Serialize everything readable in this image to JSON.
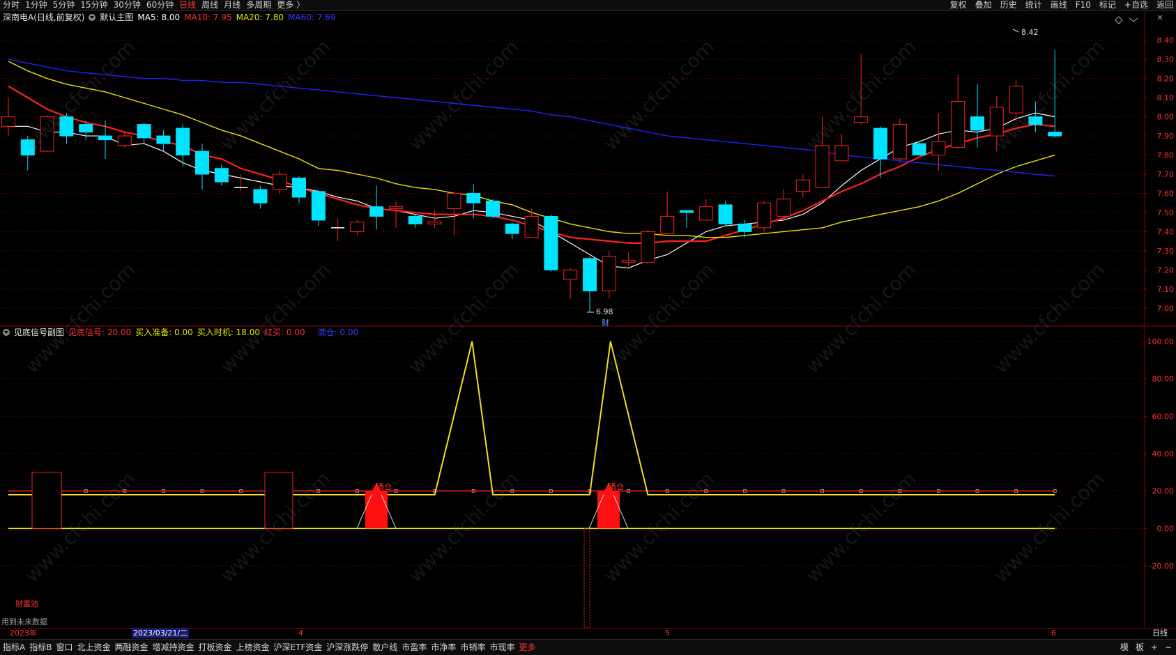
{
  "topbar": {
    "periods": [
      "分时",
      "1分钟",
      "5分钟",
      "15分钟",
      "30分钟",
      "60分钟",
      "日线",
      "周线",
      "月线",
      "多周期",
      "更多 〉"
    ],
    "active_period": "日线",
    "tools": [
      "复权",
      "叠加",
      "历史",
      "统计",
      "画线",
      "F10",
      "标记",
      "+自选",
      "返回"
    ]
  },
  "main_chart": {
    "stock": "深南电A(日线,前复权)",
    "template": "默认主图",
    "ma5": "MA5: 8.00",
    "ma10": "MA10: 7.95",
    "ma20": "MA20: 7.80",
    "ma60": "MA60: 7.69",
    "high_label": "8.42",
    "low_label": "6.98",
    "cai_mark": "财",
    "y_ticks": [
      "8.40",
      "8.30",
      "8.20",
      "8.10",
      "8.00",
      "7.90",
      "7.80",
      "7.70",
      "7.60",
      "7.50",
      "7.40",
      "7.30",
      "7.20",
      "7.10",
      "7.00"
    ],
    "colors": {
      "ma5": "#ffffff",
      "ma10": "#ff2020",
      "ma20": "#e6e600",
      "ma60": "#2020ff",
      "up": "#ff2020",
      "down": "#00e5ff"
    }
  },
  "sub_chart": {
    "name": "见底信号副图",
    "signal": "见底信号: 20.00",
    "prepare": "买入准备: 0.00",
    "timing": "买入时机: 18.00",
    "red_buy": "红买: 0.00",
    "blue_label": "満仓: 0.00",
    "full_label_1": "満仓",
    "full_label_2": "満仓",
    "y_ticks": [
      "100.00",
      "80.00",
      "60.00",
      "40.00",
      "20.00",
      "0.00",
      "-20.00"
    ],
    "note_left": "财富池",
    "note_future": "用到未来数据"
  },
  "time_axis": {
    "year": "2023年",
    "highlight_date": "2023/03/21/二",
    "month_4": "4",
    "month_5": "5",
    "month_6": "6",
    "right_label": "日线"
  },
  "bottombar": {
    "items": [
      "指标A",
      "指标B",
      "窗口",
      "北上资金",
      "两融资金",
      "增减持资金",
      "打板资金",
      "上榜资金",
      "沪深ETF资金",
      "沪深涨跌停",
      "散户线",
      "市盈率",
      "市净率",
      "市销率",
      "市现率",
      "更多"
    ],
    "right_items": [
      "模",
      "板",
      "+",
      "−"
    ]
  },
  "watermark": "www.cfchi.com",
  "chart_data": {
    "type": "candlestick",
    "ylim": [
      6.95,
      8.45
    ],
    "candles": [
      [
        7.95,
        8.0,
        8.1,
        7.9
      ],
      [
        7.88,
        7.8,
        7.9,
        7.72
      ],
      [
        7.82,
        8.0,
        8.01,
        7.82
      ],
      [
        8.0,
        7.9,
        8.02,
        7.86
      ],
      [
        7.96,
        7.92,
        7.98,
        7.88
      ],
      [
        7.9,
        7.88,
        7.98,
        7.78
      ],
      [
        7.85,
        7.9,
        7.92,
        7.84
      ],
      [
        7.96,
        7.89,
        7.97,
        7.86
      ],
      [
        7.9,
        7.86,
        7.93,
        7.82
      ],
      [
        7.94,
        7.8,
        7.96,
        7.74
      ],
      [
        7.82,
        7.7,
        7.86,
        7.62
      ],
      [
        7.73,
        7.66,
        7.75,
        7.64
      ],
      [
        7.63,
        7.63,
        7.7,
        7.61
      ],
      [
        7.62,
        7.55,
        7.64,
        7.52
      ],
      [
        7.62,
        7.7,
        7.72,
        7.6
      ],
      [
        7.68,
        7.58,
        7.69,
        7.55
      ],
      [
        7.61,
        7.46,
        7.62,
        7.43
      ],
      [
        7.42,
        7.42,
        7.47,
        7.35
      ],
      [
        7.4,
        7.45,
        7.46,
        7.38
      ],
      [
        7.53,
        7.48,
        7.64,
        7.41
      ],
      [
        7.52,
        7.53,
        7.56,
        7.42
      ],
      [
        7.48,
        7.44,
        7.49,
        7.42
      ],
      [
        7.44,
        7.45,
        7.51,
        7.42
      ],
      [
        7.52,
        7.6,
        7.61,
        7.38
      ],
      [
        7.6,
        7.55,
        7.65,
        7.47
      ],
      [
        7.56,
        7.48,
        7.57,
        7.47
      ],
      [
        7.44,
        7.39,
        7.45,
        7.36
      ],
      [
        7.37,
        7.48,
        7.52,
        7.37
      ],
      [
        7.48,
        7.2,
        7.49,
        7.19
      ],
      [
        7.15,
        7.2,
        7.21,
        7.05
      ],
      [
        7.26,
        7.09,
        7.27,
        6.98
      ],
      [
        7.09,
        7.27,
        7.3,
        7.05
      ],
      [
        7.24,
        7.25,
        7.29,
        7.22
      ],
      [
        7.24,
        7.4,
        7.41,
        7.23
      ],
      [
        7.39,
        7.48,
        7.61,
        7.38
      ],
      [
        7.51,
        7.5,
        7.51,
        7.42
      ],
      [
        7.46,
        7.53,
        7.57,
        7.46
      ],
      [
        7.54,
        7.44,
        7.56,
        7.43
      ],
      [
        7.44,
        7.4,
        7.46,
        7.37
      ],
      [
        7.42,
        7.55,
        7.56,
        7.4
      ],
      [
        7.48,
        7.57,
        7.62,
        7.47
      ],
      [
        7.61,
        7.67,
        7.7,
        7.58
      ],
      [
        7.63,
        7.85,
        8.0,
        7.63
      ],
      [
        7.77,
        7.85,
        7.91,
        7.77
      ],
      [
        7.97,
        8.0,
        8.33,
        7.96
      ],
      [
        7.94,
        7.78,
        7.95,
        7.68
      ],
      [
        7.78,
        7.96,
        7.99,
        7.76
      ],
      [
        7.86,
        7.8,
        7.87,
        7.8
      ],
      [
        7.8,
        7.87,
        8.02,
        7.72
      ],
      [
        7.84,
        8.08,
        8.22,
        7.83
      ],
      [
        8.0,
        7.93,
        8.17,
        7.84
      ],
      [
        7.9,
        8.05,
        8.11,
        7.82
      ],
      [
        8.02,
        8.16,
        8.19,
        7.98
      ],
      [
        8.0,
        7.96,
        8.08,
        7.92
      ],
      [
        7.92,
        7.9,
        8.35,
        7.89
      ]
    ],
    "series": [
      {
        "name": "MA5",
        "values": [
          7.95,
          7.95,
          7.92,
          7.92,
          7.9,
          7.9,
          7.85,
          7.86,
          7.82,
          7.76,
          7.72,
          7.7,
          7.68,
          7.66,
          7.64,
          7.63,
          7.61,
          7.58,
          7.56,
          7.52,
          7.51,
          7.49,
          7.47,
          7.48,
          7.51,
          7.5,
          7.48,
          7.46,
          7.4,
          7.34,
          7.28,
          7.22,
          7.21,
          7.25,
          7.28,
          7.34,
          7.4,
          7.43,
          7.44,
          7.45,
          7.46,
          7.49,
          7.55,
          7.64,
          7.72,
          7.78,
          7.84,
          7.87,
          7.91,
          7.93,
          7.92,
          7.94,
          7.99,
          8.02,
          8.0
        ]
      },
      {
        "name": "MA10",
        "values": [
          8.16,
          8.1,
          8.04,
          8.0,
          7.97,
          7.95,
          7.92,
          7.9,
          7.87,
          7.85,
          7.8,
          7.78,
          7.73,
          7.7,
          7.67,
          7.63,
          7.6,
          7.57,
          7.54,
          7.52,
          7.51,
          7.5,
          7.49,
          7.49,
          7.49,
          7.48,
          7.46,
          7.43,
          7.4,
          7.37,
          7.36,
          7.35,
          7.34,
          7.34,
          7.35,
          7.35,
          7.35,
          7.38,
          7.41,
          7.44,
          7.47,
          7.51,
          7.56,
          7.61,
          7.65,
          7.7,
          7.74,
          7.79,
          7.83,
          7.86,
          7.89,
          7.91,
          7.94,
          7.96,
          7.95
        ]
      },
      {
        "name": "MA20",
        "values": [
          8.29,
          8.24,
          8.2,
          8.17,
          8.15,
          8.13,
          8.1,
          8.07,
          8.04,
          8.01,
          7.97,
          7.93,
          7.9,
          7.86,
          7.82,
          7.78,
          7.73,
          7.72,
          7.7,
          7.68,
          7.65,
          7.63,
          7.62,
          7.6,
          7.59,
          7.56,
          7.54,
          7.5,
          7.47,
          7.44,
          7.42,
          7.4,
          7.39,
          7.39,
          7.38,
          7.38,
          7.37,
          7.37,
          7.38,
          7.39,
          7.4,
          7.41,
          7.42,
          7.45,
          7.47,
          7.49,
          7.51,
          7.53,
          7.56,
          7.6,
          7.65,
          7.7,
          7.74,
          7.77,
          7.8
        ]
      },
      {
        "name": "MA60",
        "values": [
          8.3,
          8.28,
          8.26,
          8.24,
          8.23,
          8.22,
          8.21,
          8.2,
          8.2,
          8.19,
          8.19,
          8.18,
          8.18,
          8.17,
          8.16,
          8.15,
          8.14,
          8.13,
          8.12,
          8.11,
          8.1,
          8.09,
          8.08,
          8.07,
          8.06,
          8.05,
          8.04,
          8.03,
          8.01,
          8.0,
          7.98,
          7.96,
          7.94,
          7.92,
          7.9,
          7.89,
          7.88,
          7.87,
          7.86,
          7.85,
          7.84,
          7.83,
          7.82,
          7.8,
          7.79,
          7.78,
          7.77,
          7.76,
          7.75,
          7.74,
          7.73,
          7.72,
          7.71,
          7.7,
          7.69
        ]
      }
    ]
  }
}
